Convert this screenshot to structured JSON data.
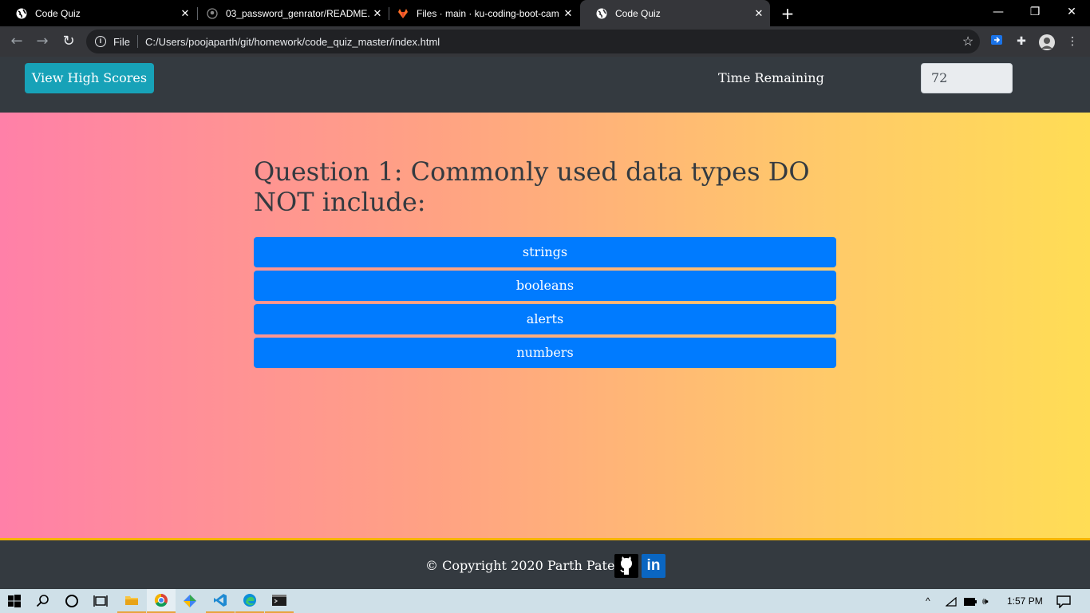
{
  "browser": {
    "tabs": [
      {
        "title": "Code Quiz",
        "icon": "globe-icon",
        "active": false
      },
      {
        "title": "03_password_genrator/README.",
        "icon": "github-icon",
        "active": false
      },
      {
        "title": "Files · main · ku-coding-boot-cam",
        "icon": "gitlab-icon",
        "active": false
      },
      {
        "title": "Code Quiz",
        "icon": "globe-icon",
        "active": true
      }
    ],
    "omnibox": {
      "scheme_label": "File",
      "url": "C:/Users/poojaparth/git/homework/code_quiz_master/index.html"
    },
    "colors": {
      "tabstrip": "#000000",
      "toolbar": "#35363a",
      "omnibox": "#202124"
    }
  },
  "page": {
    "header": {
      "high_scores_label": "View High Scores",
      "time_label": "Time Remaining",
      "time_value": "72"
    },
    "question": "Question 1: Commonly used data types DO NOT include:",
    "answers": [
      "strings",
      "booleans",
      "alerts",
      "numbers"
    ],
    "footer": {
      "copyright": "© Copyright 2020 Parth Patel",
      "linkedin_text": "in"
    },
    "colors": {
      "header_bg": "#343a40",
      "high_scores_bg": "#17a2b8",
      "answer_bg": "#007bff",
      "footer_border": "#f7b500",
      "gradient_start": "#ff80a8",
      "gradient_end": "#ffdd55"
    }
  },
  "taskbar": {
    "clock": "1:57 PM",
    "background": "#cfe0e8"
  }
}
